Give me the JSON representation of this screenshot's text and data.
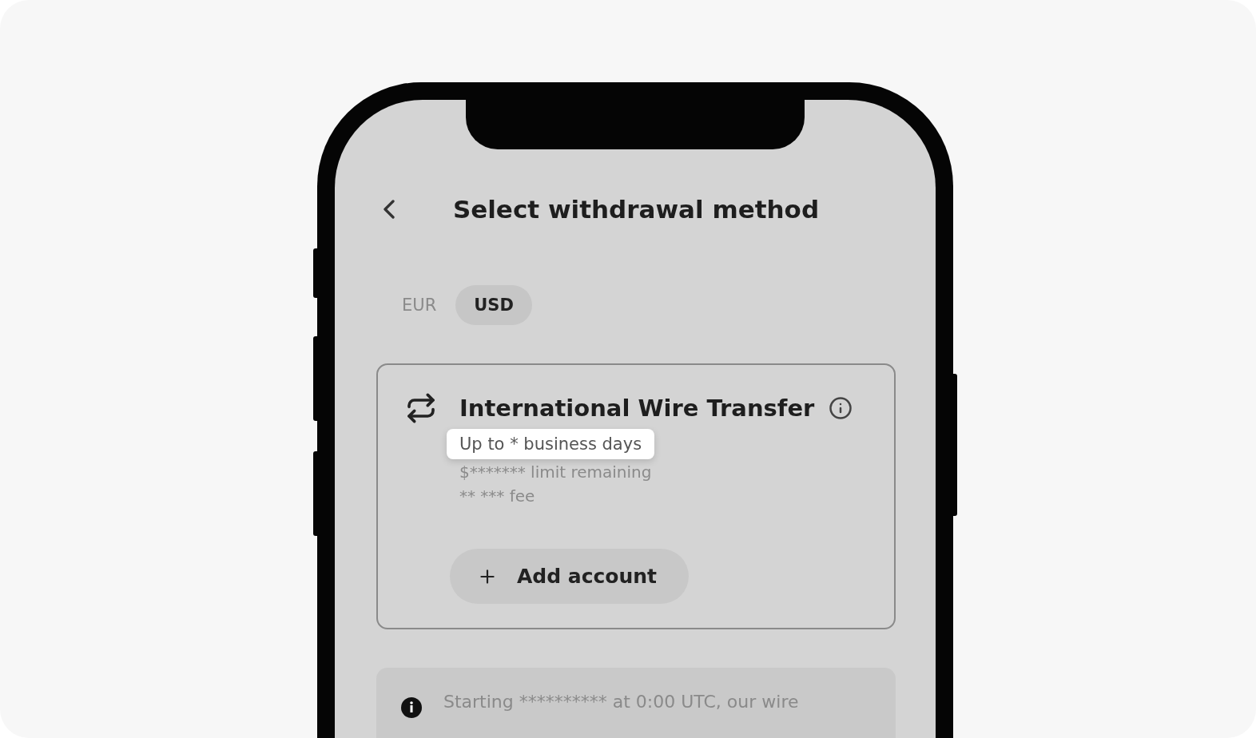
{
  "header": {
    "title": "Select withdrawal method"
  },
  "currency_tabs": [
    {
      "label": "EUR",
      "selected": false
    },
    {
      "label": "USD",
      "selected": true
    }
  ],
  "method": {
    "title": "International Wire Transfer",
    "delivery": "Up to * business days",
    "limit": "$******* limit remaining",
    "fee": "** *** fee",
    "button": "Add account"
  },
  "notice": {
    "text": "Starting ********** at 0:00 UTC, our wire"
  }
}
